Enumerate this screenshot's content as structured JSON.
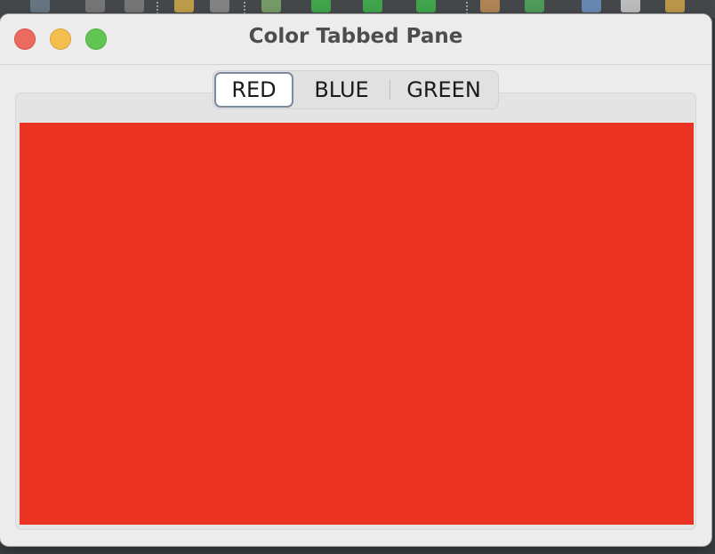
{
  "window": {
    "title": "Color Tabbed Pane",
    "controls": [
      "close-button",
      "minimize-button",
      "zoom-button"
    ]
  },
  "tabs": [
    {
      "label": "RED",
      "selected": true
    },
    {
      "label": "BLUE",
      "selected": false
    },
    {
      "label": "GREEN",
      "selected": false
    }
  ],
  "content": {
    "selected_tab": "RED",
    "color": "#ea3323"
  },
  "colors": {
    "close": "#ed6a5e",
    "minimize": "#f5bf4f",
    "zoom": "#61c554"
  }
}
